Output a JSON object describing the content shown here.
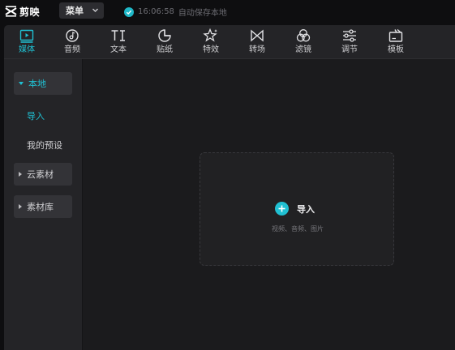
{
  "app": {
    "name": "剪映"
  },
  "topbar": {
    "menu_label": "菜单",
    "save_time": "16:06:58",
    "save_text": "自动保存本地"
  },
  "toolbar": {
    "tabs": [
      {
        "label": "媒体",
        "icon": "media-icon",
        "active": true
      },
      {
        "label": "音频",
        "icon": "audio-icon",
        "active": false
      },
      {
        "label": "文本",
        "icon": "text-icon",
        "active": false
      },
      {
        "label": "贴纸",
        "icon": "sticker-icon",
        "active": false
      },
      {
        "label": "特效",
        "icon": "effects-icon",
        "active": false
      },
      {
        "label": "转场",
        "icon": "transition-icon",
        "active": false
      },
      {
        "label": "滤镜",
        "icon": "filter-icon",
        "active": false
      },
      {
        "label": "调节",
        "icon": "adjust-icon",
        "active": false
      },
      {
        "label": "模板",
        "icon": "template-icon",
        "active": false
      }
    ]
  },
  "sidebar": {
    "groups": [
      {
        "label": "本地",
        "expanded": true,
        "active": true
      },
      {
        "label": "云素材",
        "expanded": false,
        "active": false
      },
      {
        "label": "素材库",
        "expanded": false,
        "active": false
      }
    ],
    "local_items": [
      {
        "label": "导入",
        "active": true
      },
      {
        "label": "我的预设",
        "active": false
      }
    ]
  },
  "import": {
    "label": "导入",
    "hint": "视频、音频、图片"
  },
  "colors": {
    "accent": "#20c0d2",
    "background": "#0e0e10",
    "panel": "#1b1b1d",
    "sidebar": "#242427"
  }
}
